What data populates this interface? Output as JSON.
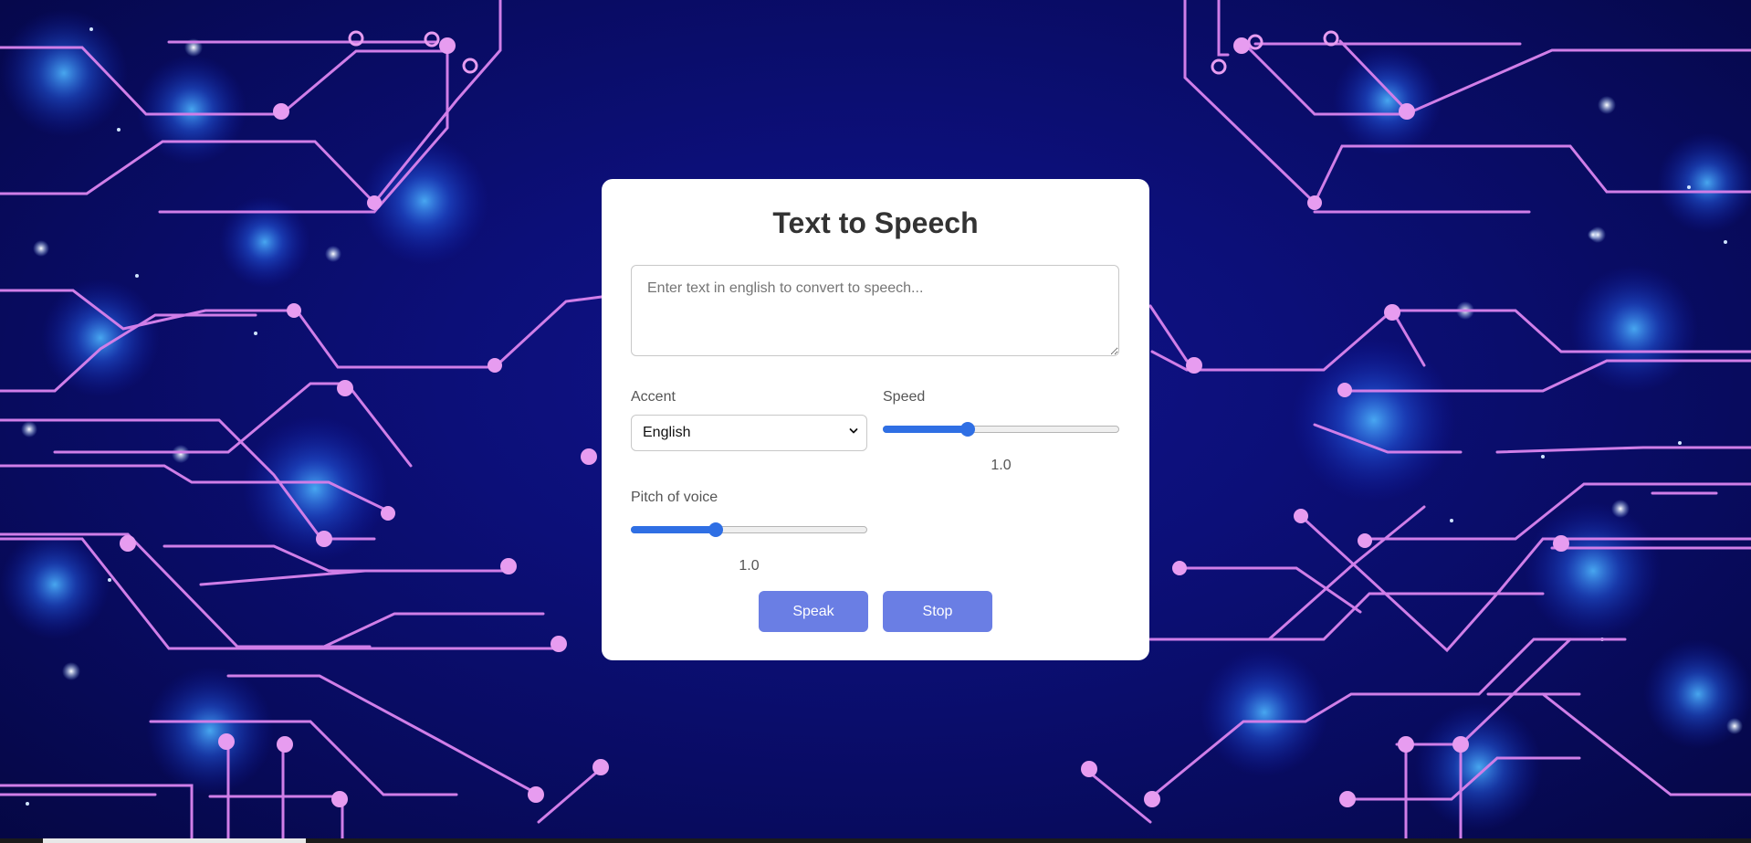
{
  "app": {
    "title": "Text to Speech"
  },
  "input": {
    "placeholder": "Enter text in english to convert to speech...",
    "value": ""
  },
  "accent": {
    "label": "Accent",
    "selected": "English"
  },
  "speed": {
    "label": "Speed",
    "value_text": "1.0",
    "fraction": 0.36
  },
  "pitch": {
    "label": "Pitch of voice",
    "value_text": "1.0",
    "fraction": 0.36
  },
  "buttons": {
    "speak_label": "Speak",
    "stop_label": "Stop"
  },
  "colors": {
    "button": "#6a7ee4",
    "slider_accent": "#2f6fe4",
    "background": "#0c0f78",
    "circuit": "#d07ee8"
  },
  "icons": {
    "select_chevron": "chevron-down-icon"
  }
}
